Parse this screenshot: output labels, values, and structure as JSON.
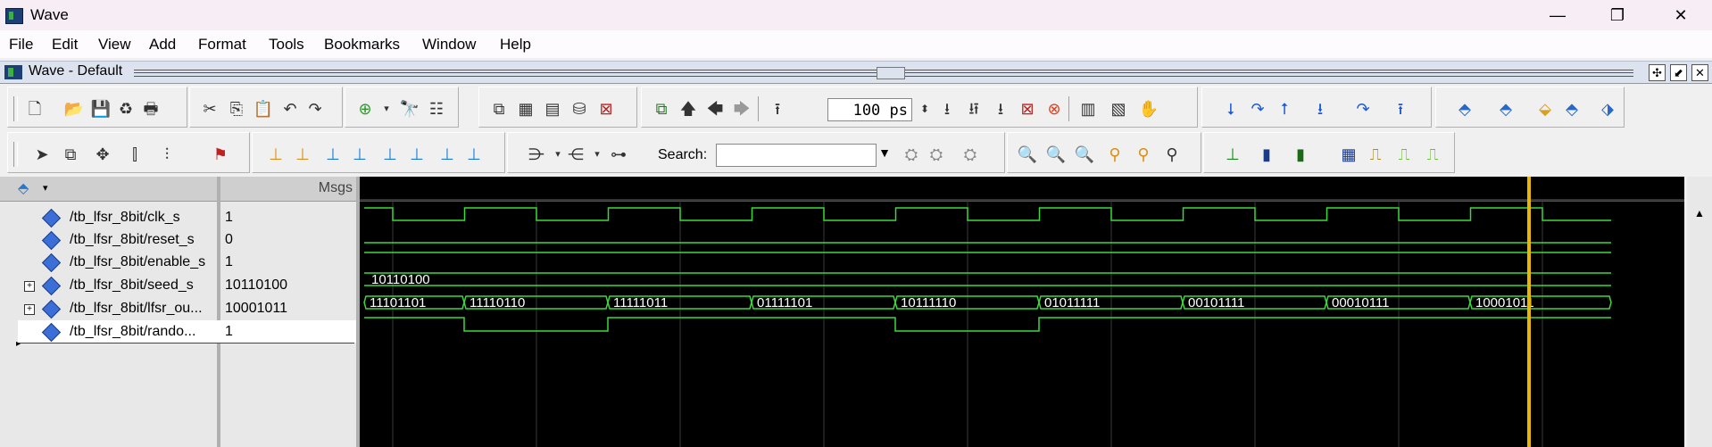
{
  "window": {
    "title": "Wave",
    "minimize": "—",
    "maximize": "❐",
    "close": "✕"
  },
  "menu": [
    "File",
    "Edit",
    "View",
    "Add",
    "Format",
    "Tools",
    "Bookmarks",
    "Window",
    "Help"
  ],
  "wave_pane": {
    "title": "Wave - Default"
  },
  "toolbar": {
    "zoom_value": "100 ps",
    "search_label": "Search:",
    "search_value": ""
  },
  "headers": {
    "values": "Msgs"
  },
  "signals": [
    {
      "name": "/tb_lfsr_8bit/clk_s",
      "value": "1",
      "expandable": false,
      "selected": false
    },
    {
      "name": "/tb_lfsr_8bit/reset_s",
      "value": "0",
      "expandable": false,
      "selected": false
    },
    {
      "name": "/tb_lfsr_8bit/enable_s",
      "value": "1",
      "expandable": false,
      "selected": false
    },
    {
      "name": "/tb_lfsr_8bit/seed_s",
      "value": "10110100",
      "expandable": true,
      "selected": false
    },
    {
      "name": "/tb_lfsr_8bit/lfsr_ou...",
      "value": "10001011",
      "expandable": true,
      "selected": false
    },
    {
      "name": "/tb_lfsr_8bit/rando...",
      "value": "1",
      "expandable": false,
      "selected": true
    }
  ],
  "waveforms": {
    "seed_label": "10110100",
    "lfsr_labels": [
      "11101101",
      "11110110",
      "11111011",
      "01111101",
      "10111110",
      "01011111",
      "00101111",
      "00010111",
      "10001011"
    ],
    "random_bits": [
      0,
      1,
      0,
      0,
      1,
      0,
      0,
      0,
      0
    ]
  },
  "colors": {
    "wave": "#3cd83c",
    "cursor": "#e8b800",
    "background": "#000000"
  }
}
